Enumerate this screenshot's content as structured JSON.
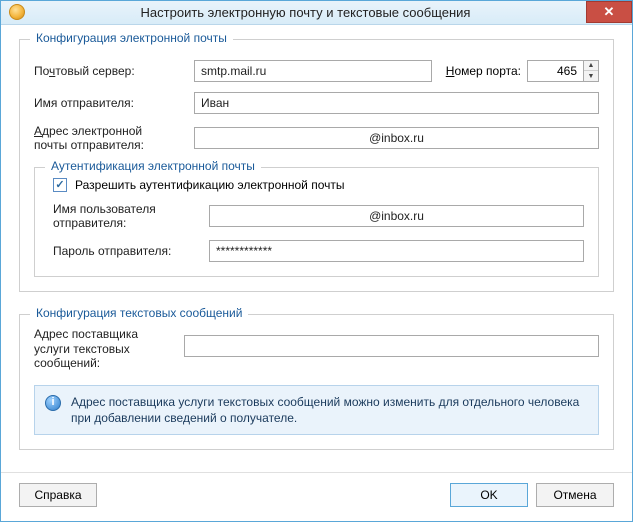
{
  "window": {
    "title": "Настроить электронную почту и текстовые сообщения",
    "close_glyph": "✕"
  },
  "email": {
    "legend": "Конфигурация электронной почты",
    "server_label_pre": "По",
    "server_label_u": "ч",
    "server_label_post": "товый сервер:",
    "server_value": "smtp.mail.ru",
    "port_label_u": "Н",
    "port_label_post": "омер порта:",
    "port_value": "465",
    "sender_name_label": "Имя отправителя:",
    "sender_name_value": "Иван",
    "sender_addr_u": "А",
    "sender_addr_label_post": "дрес электронной\nпочты отправителя:",
    "sender_addr_value": "@inbox.ru",
    "auth": {
      "legend": "Аутентификация электронной почты",
      "checkbox_label": "Разрешить аутентификацию электронной почты",
      "checkbox_checked_glyph": "✓",
      "user_label": "Имя пользователя\nотправителя:",
      "user_value": "@inbox.ru",
      "pass_label": "Пароль отправителя:",
      "pass_value": "************"
    }
  },
  "sms": {
    "legend": "Конфигурация текстовых сообщений",
    "provider_label": "Адрес поставщика\nуслуги текстовых\nсообщений:",
    "provider_value": "",
    "info_text": "Адрес поставщика услуги текстовых сообщений можно изменить для отдельного человека при добавлении сведений о получателе.",
    "info_glyph": "i"
  },
  "footer": {
    "help": "Справка",
    "ok": "OK",
    "cancel": "Отмена"
  }
}
